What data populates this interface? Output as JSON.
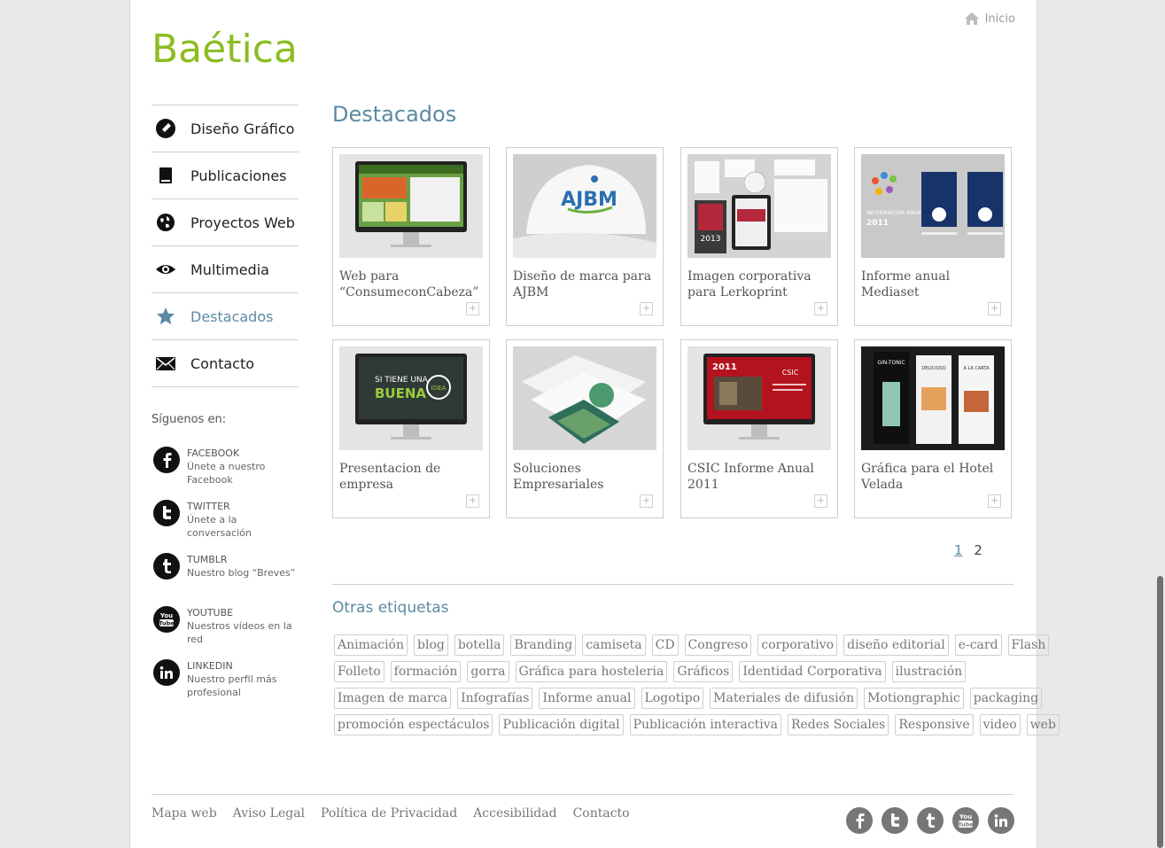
{
  "site": {
    "logo": "Baética",
    "home_label": "Inicio"
  },
  "nav": [
    {
      "label": "Diseño Gráfico",
      "icon": "pencil-icon"
    },
    {
      "label": "Publicaciones",
      "icon": "book-icon"
    },
    {
      "label": "Proyectos Web",
      "icon": "globe-icon"
    },
    {
      "label": "Multimedia",
      "icon": "eye-icon"
    },
    {
      "label": "Destacados",
      "icon": "star-icon",
      "active": true
    },
    {
      "label": "Contacto",
      "icon": "envelope-icon"
    }
  ],
  "follow": {
    "title": "Síguenos en:",
    "items": [
      {
        "name": "FACEBOOK",
        "desc": "Únete a nuestro Facebook",
        "icon": "facebook-icon"
      },
      {
        "name": "TWITTER",
        "desc": "Únete a la conversación",
        "icon": "twitter-icon"
      },
      {
        "name": "TUMBLR",
        "desc": "Nuestro blog “Breves”",
        "icon": "tumblr-icon"
      },
      {
        "name": "YOUTUBE",
        "desc": "Nuestros vídeos en la red",
        "icon": "youtube-icon"
      },
      {
        "name": "LINKEDIN",
        "desc": "Nuestro perfil más profesional",
        "icon": "linkedin-icon"
      }
    ]
  },
  "main": {
    "heading": "Destacados",
    "projects": [
      {
        "title": "Web para “ConsumeconCabeza”"
      },
      {
        "title": "Diseño de marca para AJBM"
      },
      {
        "title": "Imagen corporativa para Lerkoprint"
      },
      {
        "title": "Informe anual Mediaset"
      },
      {
        "title": "Presentacion de empresa"
      },
      {
        "title": "Soluciones Empresariales"
      },
      {
        "title": "CSIC Informe Anual 2011"
      },
      {
        "title": "Gráfica para el Hotel Velada"
      }
    ],
    "pagination": {
      "current": "1",
      "next": "2"
    }
  },
  "tags": {
    "title": "Otras etiquetas",
    "rows": [
      [
        "Animación",
        "blog",
        "botella",
        "Branding",
        "camiseta",
        "CD",
        "Congreso",
        "corporativo",
        "diseño editorial",
        "e-card",
        "Flash"
      ],
      [
        "Folleto",
        "formación",
        "gorra",
        "Gráfica para hosteleria",
        "Gráficos",
        "Identidad Corporativa",
        "ilustración"
      ],
      [
        "Imagen de marca",
        "Infografías",
        "Informe anual",
        "Logotipo",
        "Materiales de difusión",
        "Motiongraphic",
        "packaging"
      ],
      [
        "promoción espectáculos",
        "Publicación digital",
        "Publicación interactiva",
        "Redes Sociales",
        "Responsive",
        "video",
        "web"
      ]
    ]
  },
  "footer": {
    "links": [
      "Mapa web",
      "Aviso Legal",
      "Política de Privacidad",
      "Accesibilidad",
      "Contacto"
    ],
    "social_icons": [
      "facebook-icon",
      "twitter-icon",
      "tumblr-icon",
      "youtube-icon",
      "linkedin-icon"
    ]
  },
  "colors": {
    "brand": "#8cbd21",
    "accent": "#5b8aa3"
  }
}
